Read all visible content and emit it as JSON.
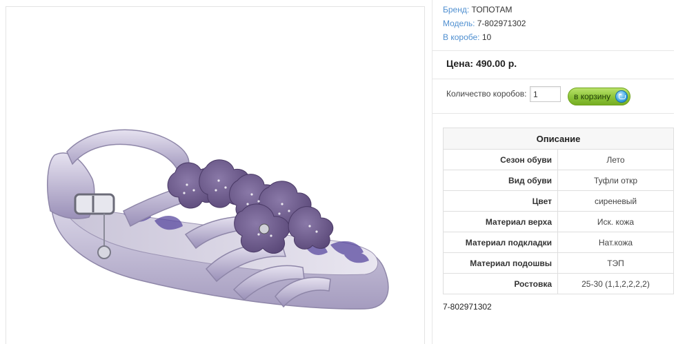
{
  "product": {
    "image_alt": "lilac-sandal",
    "brand_label": "Бренд:",
    "brand": "ТОПОТАМ",
    "model_label": "Модель:",
    "model": "7-802971302",
    "box_label": "В коробе:",
    "box_count": "10",
    "price": "Цена: 490.00 р.",
    "quantity_label": "Количество коробов:",
    "quantity_value": "1",
    "cart_button": "в корзину",
    "description_title": "Описание",
    "attributes": [
      {
        "key": "Сезон обуви",
        "value": "Лето"
      },
      {
        "key": "Вид обуви",
        "value": "Туфли откр"
      },
      {
        "key": "Цвет",
        "value": "сиреневый"
      },
      {
        "key": "Материал верха",
        "value": "Иск. кожа"
      },
      {
        "key": "Материал подкладки",
        "value": "Нат.кожа"
      },
      {
        "key": "Материал подошвы",
        "value": "ТЭП"
      },
      {
        "key": "Ростовка",
        "value": "25-30 (1,1,2,2,2,2)"
      }
    ],
    "code_footer": "7-802971302"
  },
  "colors": {
    "link_blue": "#4f8fd0",
    "button_green": "#8cc43a",
    "sandal_lilac": "#b7aed0",
    "flower_purple": "#6e5a8e"
  }
}
